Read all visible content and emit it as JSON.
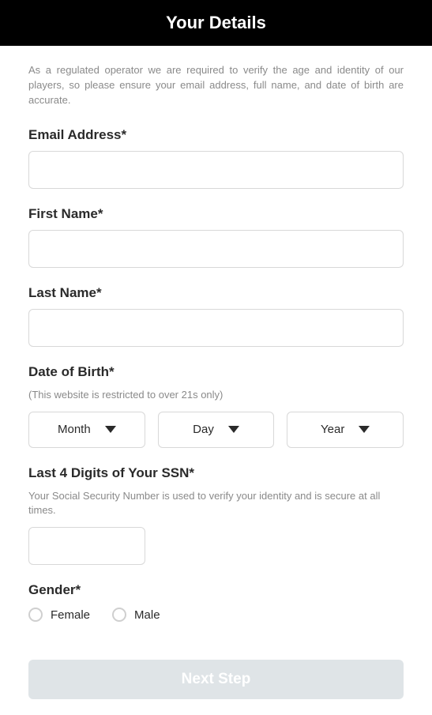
{
  "header": {
    "title": "Your Details"
  },
  "intro": "As a regulated operator we are required to verify the age and identity of our players, so please ensure your email address, full name, and date of birth are accurate.",
  "fields": {
    "email": {
      "label": "Email Address*",
      "value": ""
    },
    "firstName": {
      "label": "First Name*",
      "value": ""
    },
    "lastName": {
      "label": "Last Name*",
      "value": ""
    },
    "dob": {
      "label": "Date of Birth*",
      "helper": "(This website is restricted to over 21s only)",
      "month": "Month",
      "day": "Day",
      "year": "Year"
    },
    "ssn": {
      "label": "Last 4 Digits of Your SSN*",
      "helper": "Your Social Security Number is used to verify your identity and is secure at all times.",
      "value": ""
    },
    "gender": {
      "label": "Gender*",
      "options": {
        "female": "Female",
        "male": "Male"
      }
    }
  },
  "buttons": {
    "next": "Next Step"
  }
}
